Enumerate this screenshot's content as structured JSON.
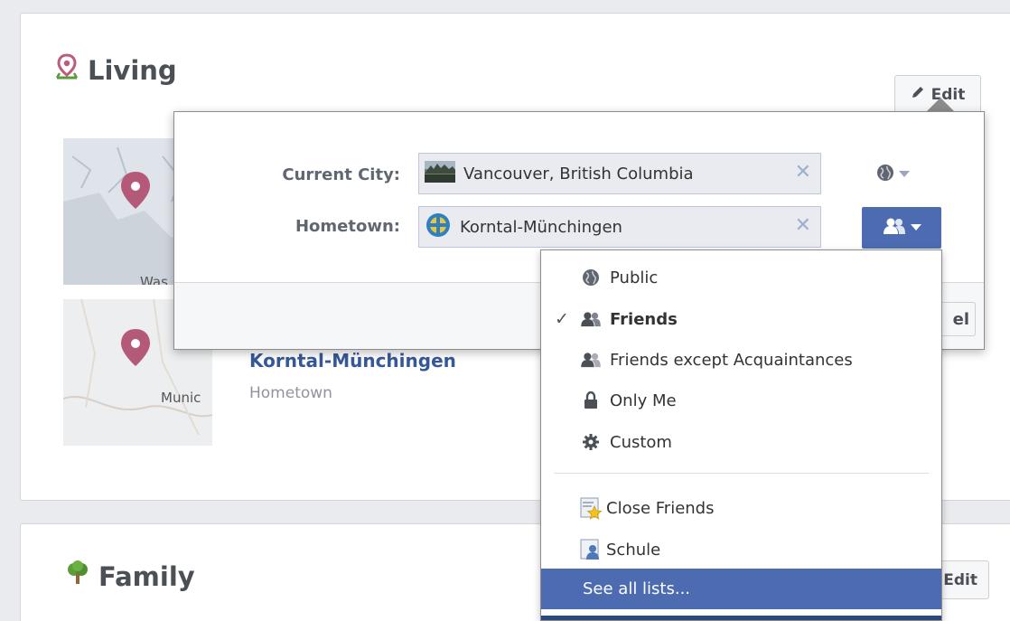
{
  "living": {
    "title": "Living",
    "edit_label": "Edit",
    "places": [
      {
        "map_label": "Was"
      },
      {
        "name": "Korntal-Münchingen",
        "sub": "Hometown",
        "map_label": "Munic"
      }
    ]
  },
  "family": {
    "title": "Family",
    "edit_label": "Edit"
  },
  "popup": {
    "current_city_label": "Current City:",
    "current_city_value": "Vancouver, British Columbia",
    "hometown_label": "Hometown:",
    "hometown_value": "Korntal-Münchingen",
    "cancel_label": "el",
    "remove_glyph": "✕"
  },
  "privacy_menu": {
    "items": [
      {
        "label": "Public",
        "icon": "globe-icon",
        "selected": false
      },
      {
        "label": "Friends",
        "icon": "friends-icon",
        "selected": true
      },
      {
        "label": "Friends except Acquaintances",
        "icon": "friends-except-icon",
        "selected": false
      },
      {
        "label": "Only Me",
        "icon": "lock-icon",
        "selected": false
      },
      {
        "label": "Custom",
        "icon": "gear-icon",
        "selected": false
      }
    ],
    "lists": [
      {
        "label": "Close Friends",
        "icon": "close-friends-star-icon"
      },
      {
        "label": "Schule",
        "icon": "list-person-icon"
      }
    ],
    "see_all": "See all lists...",
    "check_glyph": "✓"
  },
  "colors": {
    "link": "#365899",
    "highlight": "#4c6bb0",
    "pin": "#b45a78"
  }
}
